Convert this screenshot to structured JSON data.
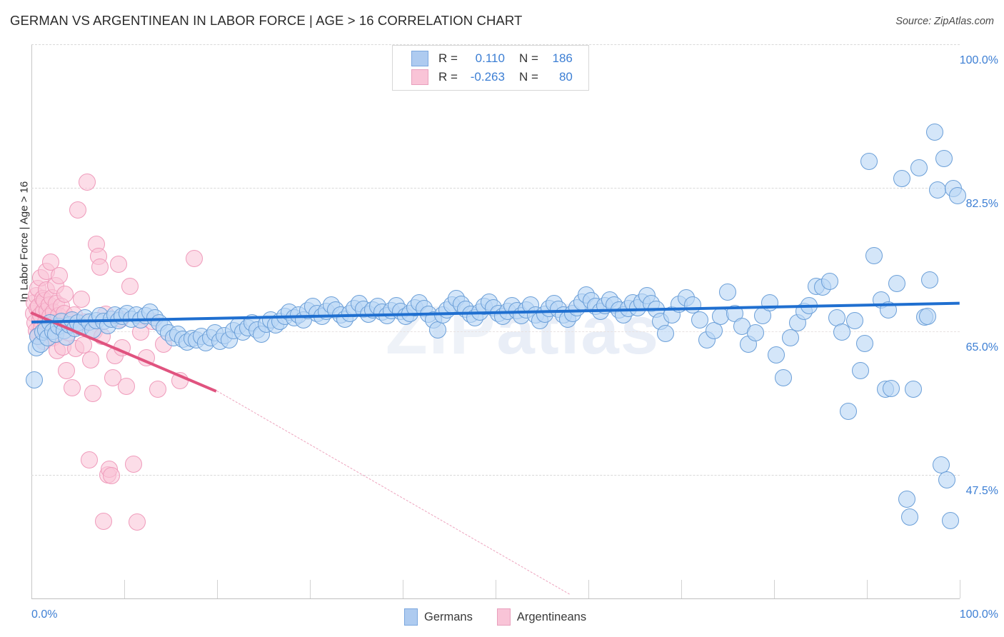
{
  "header": {
    "title": "GERMAN VS ARGENTINEAN IN LABOR FORCE | AGE > 16 CORRELATION CHART",
    "source": "Source: ZipAtlas.com"
  },
  "watermark": {
    "part1": "ZIP",
    "part2": "atlas"
  },
  "stats": {
    "rows": [
      {
        "series": "Germans",
        "r_label": "R =",
        "r_value": "0.110",
        "n_label": "N =",
        "n_value": "186",
        "color": "#aecbf0"
      },
      {
        "series": "Argentineans",
        "r_label": "R =",
        "r_value": "-0.263",
        "n_label": "N =",
        "n_value": "80",
        "color": "#f9c4d7"
      }
    ]
  },
  "legend": {
    "items": [
      {
        "label": "Germans",
        "color": "#aecbf0"
      },
      {
        "label": "Argentineans",
        "color": "#f9c4d7"
      }
    ]
  },
  "axes": {
    "y_title": "In Labor Force | Age > 16",
    "y_ticks": [
      "100.0%",
      "82.5%",
      "65.0%",
      "47.5%"
    ],
    "x_min_label": "0.0%",
    "x_max_label": "100.0%"
  },
  "chart_data": {
    "type": "scatter",
    "title": "GERMAN VS ARGENTINEAN IN LABOR FORCE | AGE > 16 CORRELATION CHART",
    "xlabel": "",
    "ylabel": "In Labor Force | Age > 16",
    "xlim": [
      0,
      100
    ],
    "ylim": [
      32.5,
      100
    ],
    "x_ticks": [
      0,
      100
    ],
    "y_ticks": [
      47.5,
      65.0,
      82.5,
      100.0
    ],
    "grid": true,
    "legend_position": "bottom",
    "series": [
      {
        "name": "Germans",
        "color": "#aecbf0",
        "r": 0.11,
        "n": 186,
        "trendline": {
          "x0": 0,
          "y0": 66.3,
          "x1": 100,
          "y1": 68.6,
          "style": "solid"
        },
        "points": [
          [
            0.3,
            59.1
          ],
          [
            0.5,
            63.0
          ],
          [
            0.7,
            64.4
          ],
          [
            1.0,
            63.4
          ],
          [
            1.2,
            64.9
          ],
          [
            1.5,
            65.2
          ],
          [
            1.8,
            64.2
          ],
          [
            2.0,
            66.0
          ],
          [
            2.3,
            65.0
          ],
          [
            2.6,
            64.6
          ],
          [
            2.9,
            65.6
          ],
          [
            3.2,
            66.2
          ],
          [
            3.5,
            65.1
          ],
          [
            3.8,
            64.3
          ],
          [
            4.1,
            65.8
          ],
          [
            4.4,
            66.4
          ],
          [
            4.7,
            65.3
          ],
          [
            5.0,
            66.0
          ],
          [
            5.4,
            65.5
          ],
          [
            5.8,
            66.6
          ],
          [
            6.2,
            66.1
          ],
          [
            6.6,
            65.2
          ],
          [
            7.0,
            66.3
          ],
          [
            7.4,
            66.9
          ],
          [
            7.8,
            66.2
          ],
          [
            8.2,
            65.7
          ],
          [
            8.6,
            66.5
          ],
          [
            9.0,
            67.0
          ],
          [
            9.4,
            66.3
          ],
          [
            9.8,
            66.8
          ],
          [
            10.3,
            67.2
          ],
          [
            10.8,
            66.5
          ],
          [
            11.3,
            67.0
          ],
          [
            11.8,
            66.4
          ],
          [
            12.3,
            66.9
          ],
          [
            12.8,
            67.3
          ],
          [
            13.3,
            66.6
          ],
          [
            13.8,
            66.0
          ],
          [
            14.3,
            65.4
          ],
          [
            14.8,
            64.8
          ],
          [
            15.3,
            64.2
          ],
          [
            15.8,
            64.6
          ],
          [
            16.3,
            64.0
          ],
          [
            16.8,
            63.7
          ],
          [
            17.3,
            64.1
          ],
          [
            17.8,
            63.9
          ],
          [
            18.3,
            64.4
          ],
          [
            18.8,
            63.6
          ],
          [
            19.3,
            64.2
          ],
          [
            19.8,
            64.8
          ],
          [
            20.3,
            63.8
          ],
          [
            20.8,
            64.5
          ],
          [
            21.3,
            63.9
          ],
          [
            21.8,
            65.1
          ],
          [
            22.3,
            65.7
          ],
          [
            22.8,
            64.9
          ],
          [
            23.3,
            65.4
          ],
          [
            23.8,
            66.0
          ],
          [
            24.3,
            65.2
          ],
          [
            24.8,
            64.6
          ],
          [
            25.3,
            65.9
          ],
          [
            25.8,
            66.4
          ],
          [
            26.3,
            65.8
          ],
          [
            26.8,
            66.2
          ],
          [
            27.3,
            66.8
          ],
          [
            27.8,
            67.3
          ],
          [
            28.3,
            66.6
          ],
          [
            28.8,
            67.0
          ],
          [
            29.3,
            66.4
          ],
          [
            29.8,
            67.5
          ],
          [
            30.3,
            68.0
          ],
          [
            30.8,
            67.2
          ],
          [
            31.3,
            66.8
          ],
          [
            31.8,
            67.4
          ],
          [
            32.3,
            68.2
          ],
          [
            32.8,
            67.6
          ],
          [
            33.3,
            67.0
          ],
          [
            33.8,
            66.5
          ],
          [
            34.3,
            67.2
          ],
          [
            34.8,
            67.8
          ],
          [
            35.3,
            68.4
          ],
          [
            35.8,
            67.7
          ],
          [
            36.3,
            67.1
          ],
          [
            36.8,
            67.6
          ],
          [
            37.3,
            68.0
          ],
          [
            37.8,
            67.3
          ],
          [
            38.3,
            66.9
          ],
          [
            38.8,
            67.5
          ],
          [
            39.3,
            68.1
          ],
          [
            39.8,
            67.4
          ],
          [
            40.3,
            66.8
          ],
          [
            40.8,
            67.2
          ],
          [
            41.3,
            67.9
          ],
          [
            41.8,
            68.5
          ],
          [
            42.3,
            67.8
          ],
          [
            42.8,
            67.1
          ],
          [
            43.3,
            66.4
          ],
          [
            43.8,
            65.2
          ],
          [
            44.3,
            67.0
          ],
          [
            44.8,
            67.6
          ],
          [
            45.3,
            68.2
          ],
          [
            45.8,
            69.0
          ],
          [
            46.3,
            68.3
          ],
          [
            46.8,
            67.7
          ],
          [
            47.3,
            67.1
          ],
          [
            47.8,
            66.6
          ],
          [
            48.3,
            67.3
          ],
          [
            48.8,
            68.0
          ],
          [
            49.3,
            68.6
          ],
          [
            49.8,
            67.9
          ],
          [
            50.3,
            67.2
          ],
          [
            50.8,
            66.8
          ],
          [
            51.3,
            67.4
          ],
          [
            51.8,
            68.1
          ],
          [
            52.3,
            67.5
          ],
          [
            52.8,
            66.9
          ],
          [
            53.3,
            67.6
          ],
          [
            53.8,
            68.2
          ],
          [
            54.3,
            67.0
          ],
          [
            54.8,
            66.3
          ],
          [
            55.3,
            67.1
          ],
          [
            55.8,
            67.8
          ],
          [
            56.3,
            68.4
          ],
          [
            56.8,
            67.7
          ],
          [
            57.3,
            67.0
          ],
          [
            57.8,
            66.5
          ],
          [
            58.3,
            67.2
          ],
          [
            58.8,
            67.9
          ],
          [
            59.3,
            68.6
          ],
          [
            59.8,
            69.4
          ],
          [
            60.3,
            68.7
          ],
          [
            60.8,
            68.0
          ],
          [
            61.3,
            67.4
          ],
          [
            61.8,
            68.1
          ],
          [
            62.3,
            68.8
          ],
          [
            62.8,
            68.2
          ],
          [
            63.3,
            67.6
          ],
          [
            63.8,
            67.0
          ],
          [
            64.3,
            67.8
          ],
          [
            64.8,
            68.5
          ],
          [
            65.3,
            67.9
          ],
          [
            65.8,
            68.6
          ],
          [
            66.3,
            69.3
          ],
          [
            66.8,
            68.4
          ],
          [
            67.3,
            67.7
          ],
          [
            67.8,
            66.2
          ],
          [
            68.3,
            64.7
          ],
          [
            69.0,
            67.0
          ],
          [
            69.8,
            68.3
          ],
          [
            70.5,
            69.1
          ],
          [
            71.2,
            68.2
          ],
          [
            72.0,
            66.4
          ],
          [
            72.8,
            63.9
          ],
          [
            73.5,
            65.1
          ],
          [
            74.2,
            66.8
          ],
          [
            75.0,
            69.8
          ],
          [
            75.8,
            67.2
          ],
          [
            76.5,
            65.6
          ],
          [
            77.2,
            63.4
          ],
          [
            78.0,
            64.8
          ],
          [
            78.8,
            66.9
          ],
          [
            79.5,
            68.5
          ],
          [
            80.2,
            62.1
          ],
          [
            81.0,
            59.3
          ],
          [
            81.8,
            64.2
          ],
          [
            82.5,
            66.0
          ],
          [
            83.2,
            67.4
          ],
          [
            83.8,
            68.1
          ],
          [
            84.5,
            70.5
          ],
          [
            85.2,
            70.4
          ],
          [
            86.0,
            71.1
          ],
          [
            86.8,
            66.6
          ],
          [
            87.3,
            64.9
          ],
          [
            88.0,
            55.2
          ],
          [
            88.7,
            66.3
          ],
          [
            89.3,
            60.2
          ],
          [
            89.8,
            63.5
          ],
          [
            90.2,
            85.7
          ],
          [
            90.8,
            74.2
          ],
          [
            91.5,
            68.8
          ],
          [
            92.0,
            57.9
          ],
          [
            92.3,
            67.6
          ],
          [
            92.6,
            58.0
          ],
          [
            93.2,
            70.8
          ],
          [
            93.8,
            83.6
          ],
          [
            94.3,
            44.5
          ],
          [
            94.6,
            42.3
          ],
          [
            95.0,
            57.9
          ],
          [
            95.6,
            84.9
          ],
          [
            96.2,
            66.7
          ],
          [
            96.5,
            66.8
          ],
          [
            96.8,
            71.3
          ],
          [
            97.3,
            89.3
          ],
          [
            97.6,
            82.2
          ],
          [
            98.0,
            48.7
          ],
          [
            98.3,
            86.1
          ],
          [
            98.6,
            46.9
          ],
          [
            99.0,
            41.9
          ],
          [
            99.3,
            82.4
          ],
          [
            99.8,
            81.5
          ]
        ]
      },
      {
        "name": "Argentineans",
        "color": "#f9c4d7",
        "r": -0.263,
        "n": 80,
        "trendline": {
          "x0": 0,
          "y0": 67.4,
          "x1": 20.0,
          "y1": 57.8,
          "style": "solid"
        },
        "trendline_extension": {
          "x0": 20.0,
          "y0": 57.8,
          "x1": 58.0,
          "y1": 33.0,
          "style": "dashed"
        },
        "points": [
          [
            0.2,
            67.2
          ],
          [
            0.3,
            68.5
          ],
          [
            0.4,
            66.0
          ],
          [
            0.5,
            69.3
          ],
          [
            0.5,
            65.1
          ],
          [
            0.6,
            67.8
          ],
          [
            0.7,
            70.2
          ],
          [
            0.7,
            64.5
          ],
          [
            0.8,
            68.0
          ],
          [
            0.9,
            66.4
          ],
          [
            1.0,
            71.5
          ],
          [
            1.0,
            67.0
          ],
          [
            1.1,
            65.3
          ],
          [
            1.2,
            69.0
          ],
          [
            1.3,
            67.4
          ],
          [
            1.3,
            63.8
          ],
          [
            1.4,
            68.7
          ],
          [
            1.5,
            66.1
          ],
          [
            1.6,
            70.0
          ],
          [
            1.6,
            72.3
          ],
          [
            1.7,
            67.5
          ],
          [
            1.8,
            65.0
          ],
          [
            1.9,
            68.2
          ],
          [
            2.0,
            66.8
          ],
          [
            2.1,
            73.4
          ],
          [
            2.2,
            69.1
          ],
          [
            2.3,
            64.2
          ],
          [
            2.4,
            67.3
          ],
          [
            2.5,
            66.0
          ],
          [
            2.6,
            70.6
          ],
          [
            2.7,
            68.4
          ],
          [
            2.8,
            62.6
          ],
          [
            2.9,
            66.9
          ],
          [
            3.0,
            71.8
          ],
          [
            3.1,
            65.5
          ],
          [
            3.2,
            68.0
          ],
          [
            3.4,
            63.1
          ],
          [
            3.5,
            67.2
          ],
          [
            3.6,
            69.5
          ],
          [
            3.8,
            60.2
          ],
          [
            4.0,
            64.8
          ],
          [
            4.2,
            66.3
          ],
          [
            4.4,
            58.1
          ],
          [
            4.6,
            67.0
          ],
          [
            4.8,
            62.9
          ],
          [
            5.0,
            79.8
          ],
          [
            5.2,
            65.6
          ],
          [
            5.4,
            68.9
          ],
          [
            5.6,
            63.3
          ],
          [
            5.8,
            66.1
          ],
          [
            6.0,
            83.2
          ],
          [
            6.2,
            49.3
          ],
          [
            6.4,
            61.5
          ],
          [
            6.6,
            57.4
          ],
          [
            6.8,
            65.0
          ],
          [
            7.0,
            75.6
          ],
          [
            7.2,
            74.1
          ],
          [
            7.4,
            72.8
          ],
          [
            7.6,
            64.4
          ],
          [
            7.8,
            41.8
          ],
          [
            8.0,
            67.1
          ],
          [
            8.2,
            47.5
          ],
          [
            8.4,
            48.2
          ],
          [
            8.6,
            47.4
          ],
          [
            8.8,
            59.3
          ],
          [
            9.0,
            62.0
          ],
          [
            9.4,
            73.2
          ],
          [
            9.6,
            66.5
          ],
          [
            9.8,
            63.0
          ],
          [
            10.2,
            58.3
          ],
          [
            10.6,
            70.5
          ],
          [
            11.0,
            48.8
          ],
          [
            11.4,
            41.7
          ],
          [
            11.8,
            64.9
          ],
          [
            12.4,
            61.8
          ],
          [
            13.0,
            66.2
          ],
          [
            13.6,
            57.9
          ],
          [
            14.2,
            63.4
          ],
          [
            16.0,
            59.0
          ],
          [
            17.5,
            73.9
          ]
        ]
      }
    ]
  }
}
